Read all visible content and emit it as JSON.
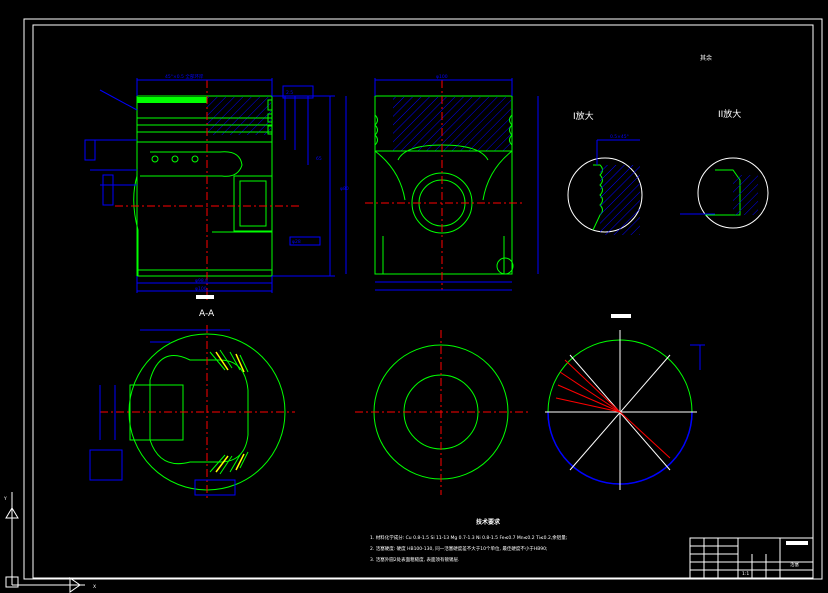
{
  "colors": {
    "background": "#000000",
    "frame": "#ffffff",
    "outline": "#00ff00",
    "dimension": "#0000ff",
    "center_line": "#ff0000",
    "hatch": "#0000ff",
    "highlight": "#00ff00",
    "text": "#ffffff",
    "label": "#ffffff",
    "accent_yellow": "#ffff00",
    "accent_red": "#ff0000",
    "blue_arc": "#0000ff"
  },
  "labels": {
    "section_aa": "A-A",
    "detail_i": "I放大",
    "detail_ii": "II放大",
    "surface_other": "其余"
  },
  "technical_requirements": {
    "title": "技术要求",
    "items": [
      "1. 材料化学成分: Cu 0.8-1.5 Si 11-13 Mg 0.7-1.3 Ni 0.8-1.5 Fe≤0.7 Mn≤0.2 Ti≤0.2,余铝量;",
      "2. 活塞硬度: 硬度 HB100-130, 同一活塞硬度差不大于10个单位, 最佳硬度不小于HB90;",
      "3. 活塞外圆2处表面粗糙度, 表面须有镀锡层."
    ]
  },
  "title_block": {
    "drawing_title": "活塞",
    "sheet_label": "1:1"
  },
  "ucs": {
    "y_label": "Y",
    "x_label": "X"
  },
  "dims": {
    "top_chamfer": "45°×0.5 全部环岸",
    "overall_width": "φ100",
    "height_main": "φ80",
    "bottom_width": "φ98.8",
    "bottom_width2": "φ100",
    "pin_hole": "φ28",
    "right_h": "65",
    "side_62": "62",
    "ring1": "2.5",
    "ring2": "2.5",
    "ring3": "4",
    "roughness": "1.6",
    "radius_r2": "R2",
    "detail_i_val": "0.5×45°"
  }
}
